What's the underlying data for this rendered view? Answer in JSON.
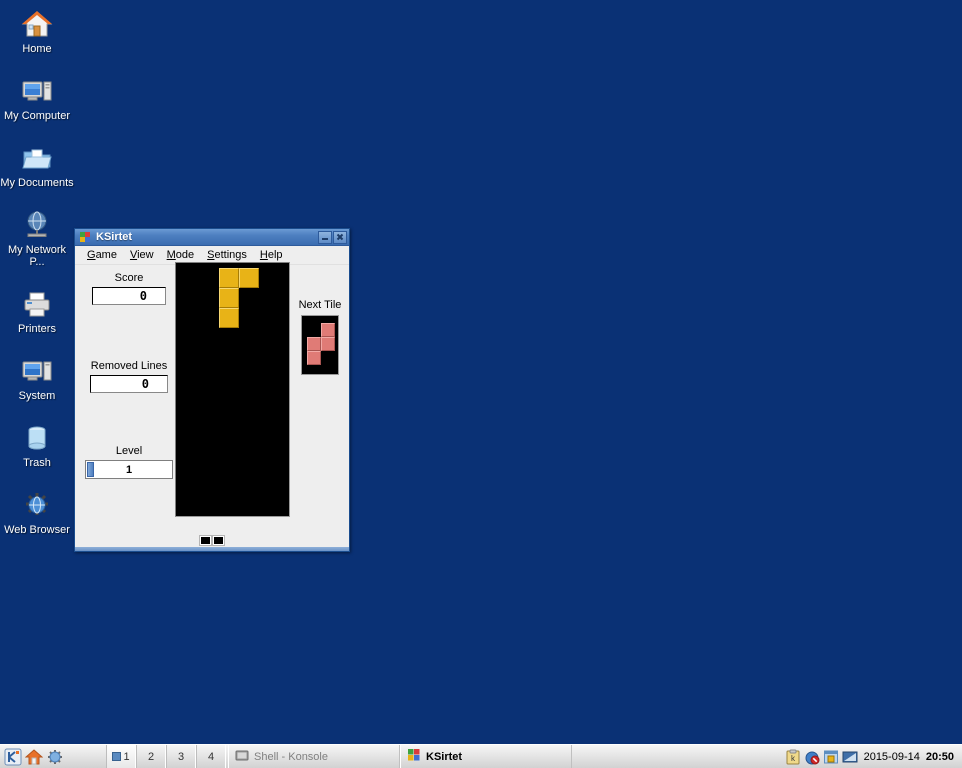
{
  "desktop": {
    "background_color": "#0a3175",
    "icons": [
      {
        "label": "Home",
        "icon": "home-icon"
      },
      {
        "label": "My Computer",
        "icon": "computer-icon"
      },
      {
        "label": "My Documents",
        "icon": "documents-folder-icon"
      },
      {
        "label": "My Network P...",
        "icon": "network-globe-icon"
      },
      {
        "label": "Printers",
        "icon": "printer-icon"
      },
      {
        "label": "System",
        "icon": "system-computer-icon"
      },
      {
        "label": "Trash",
        "icon": "trash-icon"
      },
      {
        "label": "Web Browser",
        "icon": "web-browser-icon"
      }
    ]
  },
  "window": {
    "title": "KSirtet",
    "icon": "ksirtet-app-icon",
    "buttons": {
      "minimize": "minimize-button",
      "close": "close-button"
    },
    "menu": [
      {
        "label": "Game",
        "accel": "G"
      },
      {
        "label": "View",
        "accel": "V"
      },
      {
        "label": "Mode",
        "accel": "M"
      },
      {
        "label": "Settings",
        "accel": "S"
      },
      {
        "label": "Help",
        "accel": "H"
      }
    ],
    "stats": {
      "score_label": "Score",
      "score_value": "0",
      "lines_label": "Removed Lines",
      "lines_value": "0",
      "level_label": "Level",
      "level_value": "1"
    },
    "next_tile_label": "Next Tile",
    "status_squares": 2
  },
  "game_board": {
    "background_color": "#000000",
    "columns": 10,
    "rows": 22,
    "cell_size": 20,
    "current_piece": {
      "type": "J",
      "color": "#e8b317",
      "cells": [
        [
          0,
          0
        ],
        [
          1,
          0
        ],
        [
          0,
          1
        ],
        [
          0,
          2
        ]
      ]
    },
    "next_piece": {
      "type": "S",
      "color": "#e07b76",
      "cells": [
        [
          1,
          0
        ],
        [
          0,
          1
        ],
        [
          1,
          1
        ],
        [
          0,
          2
        ]
      ]
    }
  },
  "taskbar": {
    "quicklaunch": [
      {
        "icon": "kmenu-icon",
        "name": "k-menu"
      },
      {
        "icon": "home-folder-icon",
        "name": "home-folder"
      },
      {
        "icon": "web-browser-icon",
        "name": "web-browser"
      }
    ],
    "pager": [
      {
        "label": "1",
        "active": true
      },
      {
        "label": "2",
        "active": false
      },
      {
        "label": "3",
        "active": false
      },
      {
        "label": "4",
        "active": false
      }
    ],
    "tasks": [
      {
        "label": "Shell - Konsole",
        "icon": "konsole-icon",
        "active": false
      },
      {
        "label": "KSirtet",
        "icon": "ksirtet-app-icon",
        "active": true
      }
    ],
    "systray": [
      {
        "icon": "klipper-clipboard-icon"
      },
      {
        "icon": "kget-drop-icon"
      },
      {
        "icon": "window-list-icon"
      },
      {
        "icon": "display-settings-icon"
      }
    ],
    "clock": {
      "date": "2015-09-14",
      "time": "20:50"
    }
  }
}
